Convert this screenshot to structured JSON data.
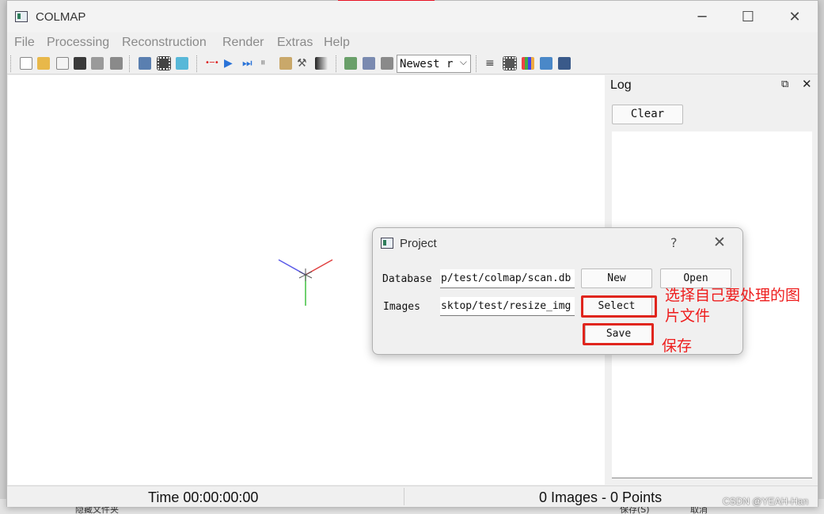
{
  "window": {
    "title": "COLMAP"
  },
  "window_controls": {
    "minimize": "─",
    "maximize": "☐",
    "close": "✕"
  },
  "menu": [
    "File",
    "Processing",
    "Reconstruction",
    "Render",
    "Extras",
    "Help"
  ],
  "toolbar": {
    "render_select_value": "Newest r",
    "render_select_arrow": "⌵"
  },
  "log": {
    "title": "Log",
    "float_glyph": "⧉",
    "close_glyph": "✕",
    "clear_label": "Clear"
  },
  "status": {
    "time": "Time 00:00:00:00",
    "counts": "0 Images - 0 Points"
  },
  "dialog": {
    "title": "Project",
    "help_glyph": "?",
    "close_glyph": "✕",
    "database_label": "Database",
    "database_value": "p/test/colmap/scan.db",
    "images_label": "Images",
    "images_value": "sktop/test/resize_img",
    "new_label": "New",
    "open_label": "Open",
    "select_label": "Select",
    "save_label": "Save"
  },
  "annotations": {
    "select_note_line1": "选择自己要处理的图",
    "select_note_line2": "片文件",
    "save_note": "保存"
  },
  "background_window": {
    "left_text": "隐藏文件夹",
    "save_text": "保存(S)",
    "cancel_text": "取消"
  },
  "watermark": "CSDN @YEAH-Han",
  "colors": {
    "annotation_red": "#e0251d",
    "axis_x": "#e04040",
    "axis_y": "#40c040",
    "axis_z": "#5a5ae8"
  },
  "icons": [
    "new-project-icon",
    "open-project-icon",
    "edit-project-icon",
    "save-project-icon",
    "import-icon",
    "export-icon",
    "feature-extraction-icon",
    "feature-matching-icon",
    "database-management-icon",
    "automatic-reconstruction-icon",
    "start-reconstruction-icon",
    "step-reconstruction-icon",
    "pause-icon",
    "reconstruction-options-icon",
    "bundle-adjustment-icon",
    "dense-reconstruction-icon",
    "render-options-icon",
    "reset-view-icon",
    "grab-image-icon",
    "reconstruction-stats-icon",
    "match-matrix-icon",
    "log-icon",
    "screenshot-icon",
    "grab-movie-icon"
  ]
}
